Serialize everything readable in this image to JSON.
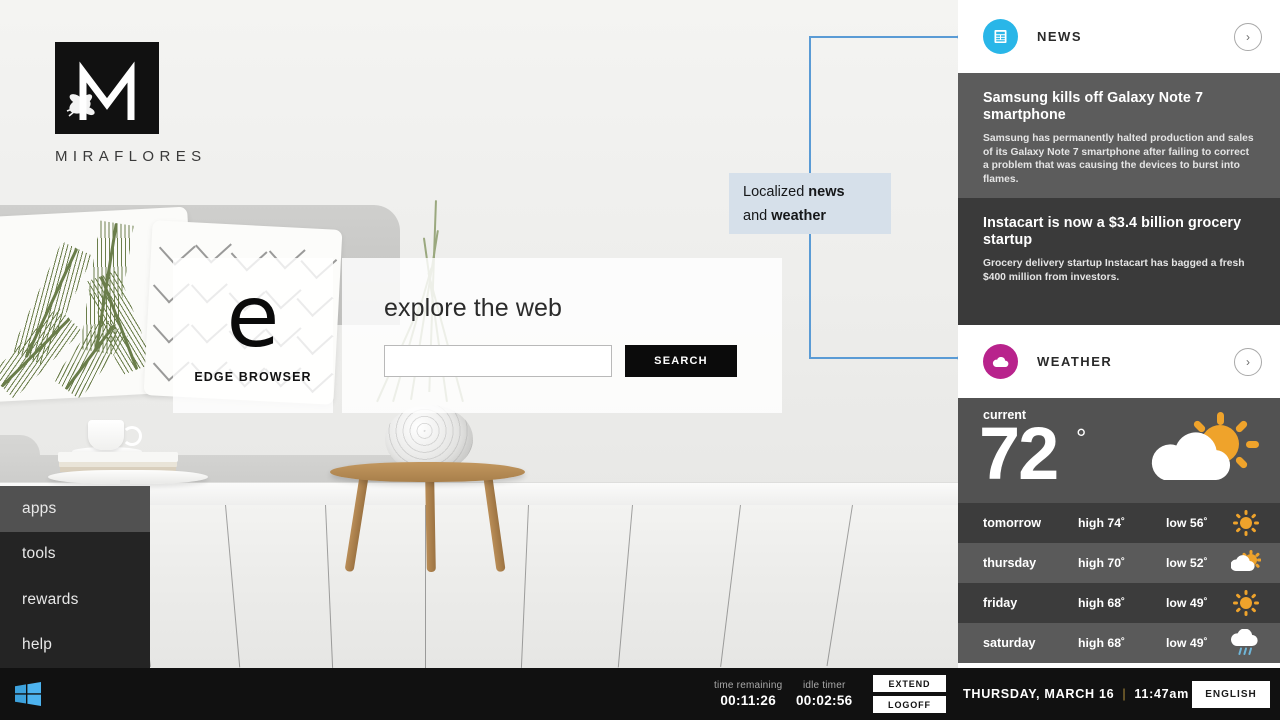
{
  "brand": {
    "name": "MIRAFLORES",
    "logo_letter": "M"
  },
  "left_menu": {
    "items": [
      {
        "label": "apps",
        "active": true
      },
      {
        "label": "tools",
        "active": false
      },
      {
        "label": "rewards",
        "active": false
      },
      {
        "label": "help",
        "active": false
      }
    ]
  },
  "edge_tile": {
    "label": "EDGE BROWSER",
    "glyph": "e",
    "icon": "edge-browser-icon"
  },
  "search": {
    "title": "explore the web",
    "input_value": "",
    "placeholder": "",
    "button_label": "SEARCH"
  },
  "callout": {
    "text_line1_plain": "Localized ",
    "text_line1_bold": "news",
    "text_line2_plain": "and ",
    "text_line2_bold": "weather",
    "line_color": "#5a9bd5",
    "box_color": "#d6e0ea"
  },
  "news": {
    "section_label": "NEWS",
    "icon": "newspaper-icon",
    "accent_color": "#29b6e8",
    "chevron": "›",
    "items": [
      {
        "headline": "Samsung kills off Galaxy Note 7 smartphone",
        "body": "Samsung has permanently halted production and sales of its Galaxy Note 7 smartphone after failing to correct a problem that was causing the devices to burst into flames.",
        "bg": "#5c5c5c"
      },
      {
        "headline": "Instacart is now a $3.4 billion grocery startup",
        "body": "Grocery delivery startup Instacart has bagged a fresh $400 million from investors.",
        "bg": "#3a3a3a"
      }
    ]
  },
  "weather": {
    "section_label": "WEATHER",
    "icon": "cloud-icon",
    "accent_color": "#b8238c",
    "chevron": "›",
    "current": {
      "label": "current",
      "temp": "72",
      "degree": "°",
      "icon": "partly-cloudy-icon"
    },
    "forecast": [
      {
        "day": "tomorrow",
        "high": "high 74˚",
        "low": "low 56˚",
        "icon": "sun-icon"
      },
      {
        "day": "thursday",
        "high": "high 70˚",
        "low": "low 52˚",
        "icon": "partly-cloudy-icon"
      },
      {
        "day": "friday",
        "high": "high 68˚",
        "low": "low 49˚",
        "icon": "sun-icon"
      },
      {
        "day": "saturday",
        "high": "high 68˚",
        "low": "low 49˚",
        "icon": "rain-icon"
      }
    ]
  },
  "taskbar": {
    "start_icon": "windows-logo-icon",
    "time_remaining_label": "time remaining",
    "time_remaining_value": "00:11:26",
    "idle_timer_label": "idle timer",
    "idle_timer_value": "00:02:56",
    "extend_label": "EXTEND",
    "logoff_label": "LOGOFF",
    "date": "THURSDAY, MARCH 16",
    "separator": "|",
    "time": "11:47am",
    "language": "ENGLISH"
  }
}
